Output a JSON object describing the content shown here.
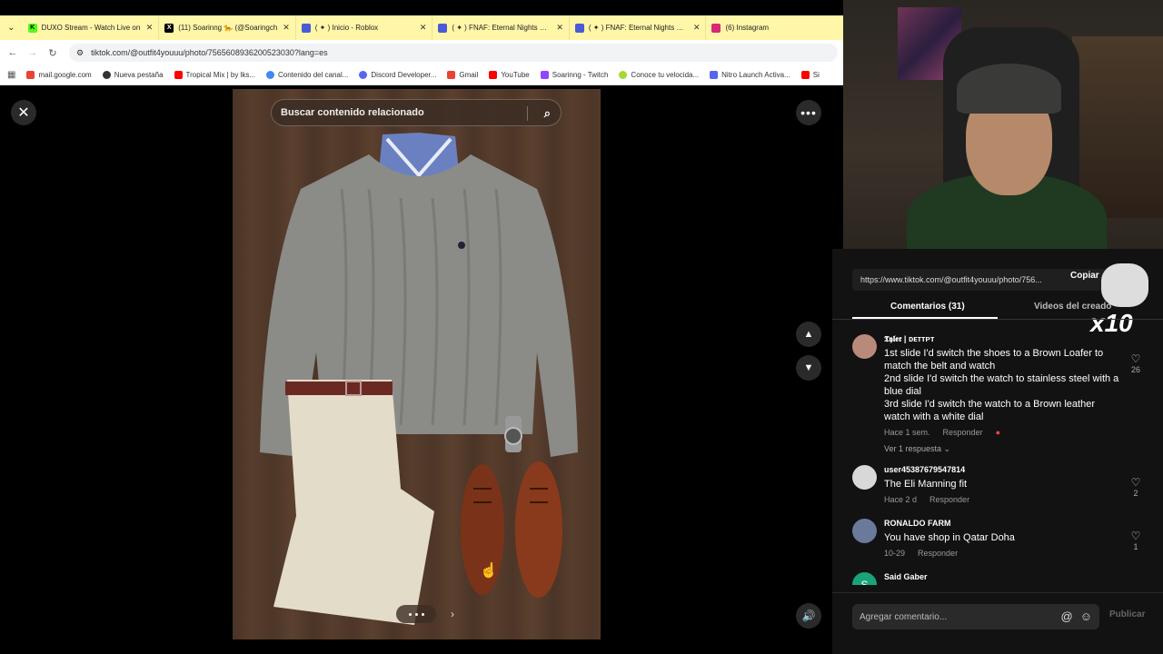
{
  "browser": {
    "tabs": [
      {
        "title": "DUXO Stream - Watch Live on",
        "fav_color": "#53fc18",
        "fav_glyph": "K"
      },
      {
        "title": "(11) Soarinng 🐆 (@Soaringch",
        "fav_color": "#000000",
        "fav_glyph": "X"
      },
      {
        "title": "( ✦ ) Inicio - Roblox",
        "fav_color": "#4a5bd6",
        "fav_glyph": ""
      },
      {
        "title": "( ✦ ) FNAF: Eternal Nights 🌧 -",
        "fav_color": "#4a5bd6",
        "fav_glyph": ""
      },
      {
        "title": "( ✦ ) FNAF: Eternal Nights 🌧 -",
        "fav_color": "#4a5bd6",
        "fav_glyph": ""
      },
      {
        "title": "(6) Instagram",
        "fav_color": "#d62976",
        "fav_glyph": ""
      }
    ],
    "tab_close": "✕",
    "url": "tiktok.com/@outfit4youuu/photo/7565608936200523030?lang=es",
    "bookmarks": [
      {
        "label": "mail.google.com",
        "color": "#ea4335"
      },
      {
        "label": "Nueva pestaña",
        "color": "#333333"
      },
      {
        "label": "Tropical Mix | by lks...",
        "color": "#ff0000"
      },
      {
        "label": "Contenido del canal...",
        "color": "#4285f4"
      },
      {
        "label": "Discord Developer...",
        "color": "#5865f2"
      },
      {
        "label": "Gmail",
        "color": "#ea4335"
      },
      {
        "label": "YouTube",
        "color": "#ff0000"
      },
      {
        "label": "Soarinng - Twitch",
        "color": "#9146ff"
      },
      {
        "label": "Conoce tu velocida...",
        "color": "#a6d92f"
      },
      {
        "label": "Nitro Launch Activa...",
        "color": "#5865f2"
      },
      {
        "label": "Si",
        "color": "#ff0000"
      }
    ]
  },
  "viewer": {
    "search_placeholder": "Buscar contenido relacionado",
    "close_glyph": "✕",
    "more_glyph": "•••",
    "up_glyph": "▲",
    "down_glyph": "▼",
    "volume_glyph": "🔊",
    "prev_glyph": "‹",
    "next_glyph": "›"
  },
  "panel": {
    "share_link": "https://www.tiktok.com/@outfit4youuu/photo/756...",
    "copy_label": "Copiar",
    "overlay_text": "x10",
    "tabs": {
      "comments": "Comentarios (31)",
      "creator_videos": "Videos del creado"
    },
    "comments": [
      {
        "user": "𝕿𝖞𝖑𝖊𝖗 | ᴅᴇᴛᴛᴘᴛ",
        "text": "1st slide I'd switch the shoes to a Brown Loafer to match the belt and watch\n2nd slide I'd switch the watch to stainless steel with a blue dial\n3rd slide I'd switch the watch to a Brown leather watch with a white dial",
        "time": "Hace 1 sem.",
        "reply": "Responder",
        "likes": "26",
        "more_replies": "Ver 1 respuesta ⌄",
        "avatar_color": "#b98a7a"
      },
      {
        "user": "user45387679547814",
        "text": "The Eli Manning fit",
        "time": "Hace 2 d",
        "reply": "Responder",
        "likes": "2",
        "avatar_color": "#d8d8d8"
      },
      {
        "user": "RONALDO FARM",
        "text": "You have shop in Qatar Doha",
        "time": "10-29",
        "reply": "Responder",
        "likes": "1",
        "avatar_color": "#6a7a9a"
      },
      {
        "user": "Said Gaber",
        "text": "",
        "avatar_color": "#1aa37a",
        "avatar_letter": "S"
      }
    ],
    "composer_placeholder": "Agregar comentario...",
    "mention_glyph": "@",
    "emoji_glyph": "☺",
    "publish_label": "Publicar"
  }
}
